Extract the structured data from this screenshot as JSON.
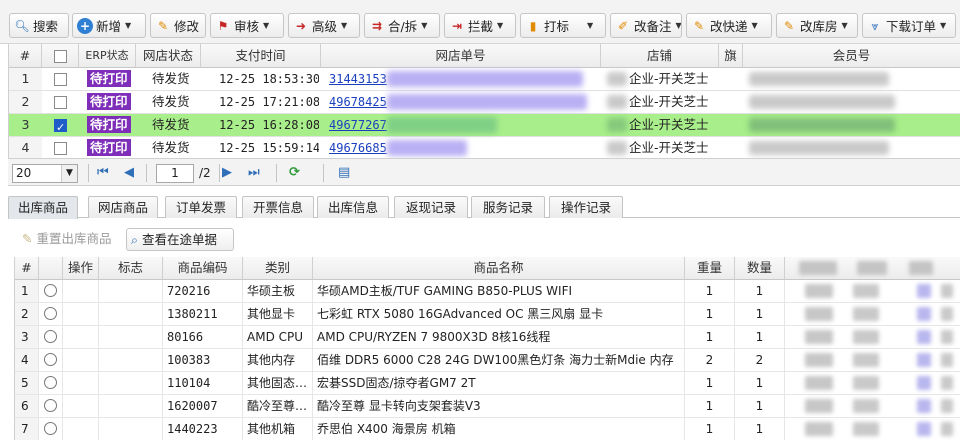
{
  "toolbar": [
    {
      "label": "搜索",
      "icon": "magnifier-icon"
    },
    {
      "label": "新增",
      "icon": "plus-circle-icon",
      "caret": true
    },
    {
      "label": "修改",
      "icon": "edit-icon"
    },
    {
      "label": "审核",
      "icon": "check-flag-icon",
      "caret": true
    },
    {
      "label": "高级",
      "icon": "arrow-split-icon",
      "caret": true
    },
    {
      "label": "合/拆",
      "icon": "merge-split-icon",
      "caret": true
    },
    {
      "label": "拦截",
      "icon": "intercept-icon",
      "caret": true
    },
    {
      "label": "打标",
      "icon": "bookmark-icon",
      "caret": true
    },
    {
      "label": "改备注",
      "icon": "note-icon",
      "caret": true
    },
    {
      "label": "改快递",
      "icon": "express-edit-icon",
      "caret": true
    },
    {
      "label": "改库房",
      "icon": "warehouse-edit-icon",
      "caret": true
    },
    {
      "label": "下载订单",
      "icon": "download-icon",
      "caret": true
    }
  ],
  "orders": {
    "columns": [
      "#",
      "",
      "ERP状态",
      "网店状态",
      "支付时间",
      "网店单号",
      "店铺",
      "旗",
      "会员号"
    ],
    "rows": [
      {
        "num": "1",
        "checked": false,
        "erp_status": "待打印",
        "shop_status": "待发货",
        "pay_time": "12-25 18:53:30",
        "order_no": "31443153",
        "shop": "企业-开关芝士"
      },
      {
        "num": "2",
        "checked": false,
        "erp_status": "待打印",
        "shop_status": "待发货",
        "pay_time": "12-25 17:21:08",
        "order_no": "49678425",
        "shop": "企业-开关芝士"
      },
      {
        "num": "3",
        "checked": true,
        "erp_status": "待打印",
        "shop_status": "待发货",
        "pay_time": "12-25 16:28:08",
        "order_no": "49677267",
        "shop": "企业-开关芝士"
      },
      {
        "num": "4",
        "checked": false,
        "erp_status": "待打印",
        "shop_status": "待发货",
        "pay_time": "12-25 15:59:14",
        "order_no": "49676685",
        "shop": "企业-开关芝士"
      }
    ]
  },
  "pager": {
    "page_size": "20",
    "current_page": "1",
    "total_pages": "/2"
  },
  "tabs": [
    "出库商品",
    "网店商品",
    "订单发票",
    "开票信息",
    "出库信息",
    "返现记录",
    "服务记录",
    "操作记录"
  ],
  "subbar": {
    "reset_label": "重置出库商品",
    "view_label": "查看在途单据"
  },
  "products": {
    "columns": [
      "#",
      "",
      "操作",
      "标志",
      "商品编码",
      "类别",
      "商品名称",
      "重量",
      "数量"
    ],
    "rows": [
      {
        "num": "1",
        "code": "720216",
        "category": "华硕主板",
        "name": "华硕AMD主板/TUF GAMING B850-PLUS WIFI",
        "weight": "1",
        "qty": "1"
      },
      {
        "num": "2",
        "code": "1380211",
        "category": "其他显卡",
        "name": "七彩虹 RTX 5080 16GAdvanced OC 黑三风扇 显卡",
        "weight": "1",
        "qty": "1"
      },
      {
        "num": "3",
        "code": "80166",
        "category": "AMD CPU",
        "name": "AMD CPU/RYZEN 7 9800X3D 8核16线程",
        "weight": "1",
        "qty": "1"
      },
      {
        "num": "4",
        "code": "100383",
        "category": "其他内存",
        "name": "佰维 DDR5 6000 C28 24G DW100黑色灯条 海力士新Mdie 内存",
        "weight": "2",
        "qty": "2"
      },
      {
        "num": "5",
        "code": "110104",
        "category": "其他固态…",
        "name": "宏碁SSD固态/掠夺者GM7 2T",
        "weight": "1",
        "qty": "1"
      },
      {
        "num": "6",
        "code": "1620007",
        "category": "酷冷至尊…",
        "name": "酷冷至尊 显卡转向支架套装V3",
        "weight": "1",
        "qty": "1"
      },
      {
        "num": "7",
        "code": "1440223",
        "category": "其他机箱",
        "name": "乔思伯 X400 海景房 机箱",
        "weight": "1",
        "qty": "1"
      }
    ]
  },
  "colors": {
    "selected_row": "#a8ee8a",
    "badge": "#7e2eb8",
    "link": "#1a3fbf"
  }
}
